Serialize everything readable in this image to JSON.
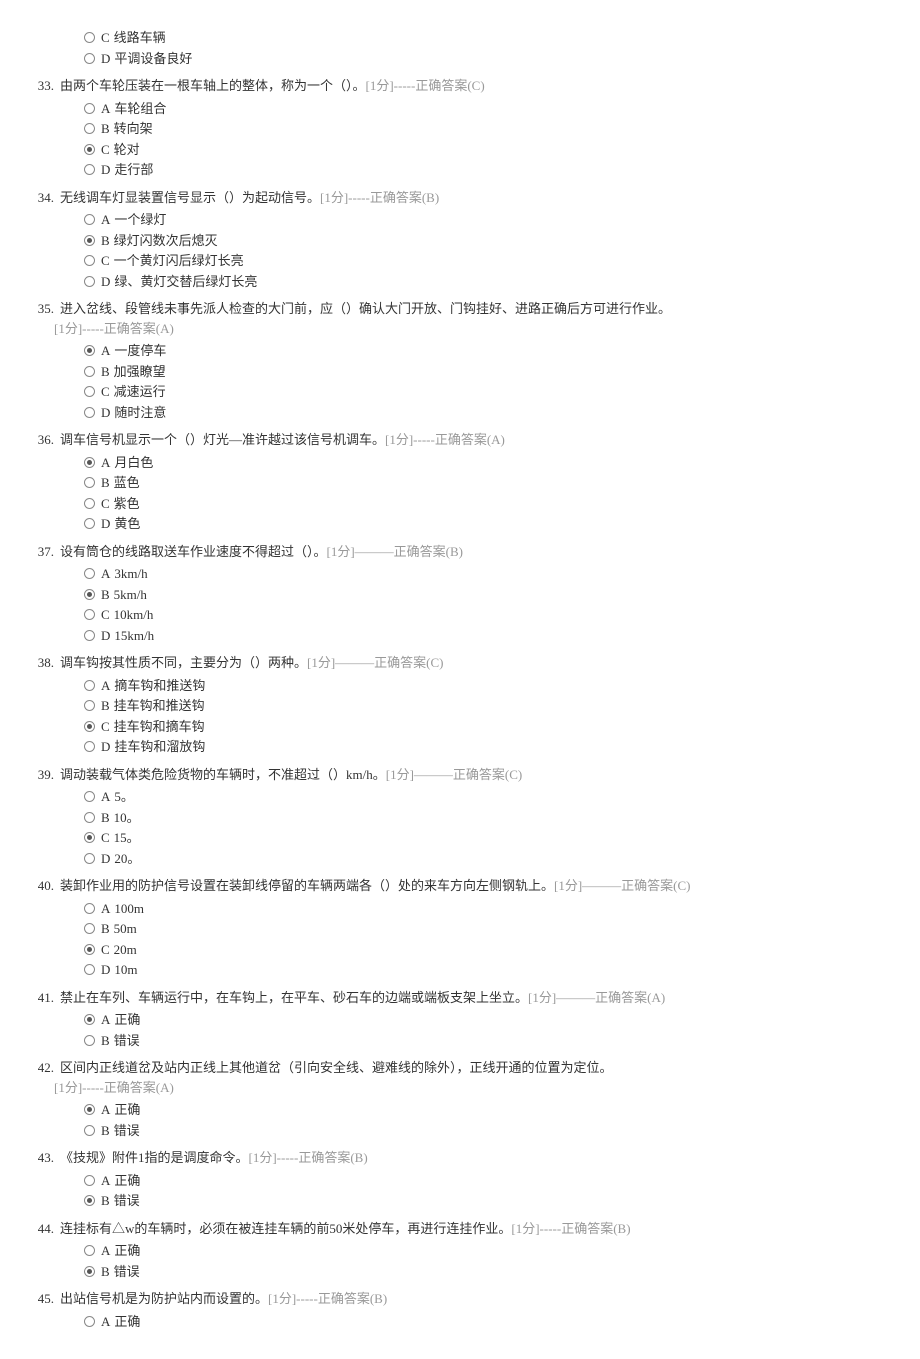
{
  "pretail_options": [
    {
      "letter": "C",
      "text": "线路车辆",
      "selected": false
    },
    {
      "letter": "D",
      "text": "平调设备良好",
      "selected": false
    }
  ],
  "questions": [
    {
      "number": "33.",
      "text": "由两个车轮压装在一根车轴上的整体，称为一个（）。",
      "meta": "[1分]-----正确答案(C)",
      "meta_on_newline": false,
      "options": [
        {
          "letter": "A",
          "text": "车轮组合",
          "selected": false
        },
        {
          "letter": "B",
          "text": "转向架",
          "selected": false
        },
        {
          "letter": "C",
          "text": "轮对",
          "selected": true
        },
        {
          "letter": "D",
          "text": "走行部",
          "selected": false
        }
      ]
    },
    {
      "number": "34.",
      "text": "无线调车灯显装置信号显示（）为起动信号。",
      "meta": "[1分]-----正确答案(B)",
      "meta_on_newline": false,
      "options": [
        {
          "letter": "A",
          "text": "一个绿灯",
          "selected": false
        },
        {
          "letter": "B",
          "text": "绿灯闪数次后熄灭",
          "selected": true
        },
        {
          "letter": "C",
          "text": "一个黄灯闪后绿灯长亮",
          "selected": false
        },
        {
          "letter": "D",
          "text": "绿、黄灯交替后绿灯长亮",
          "selected": false
        }
      ]
    },
    {
      "number": "35.",
      "text": "进入岔线、段管线未事先派人检查的大门前，应（）确认大门开放、门钩挂好、进路正确后方可进行作业。",
      "meta": "[1分]-----正确答案(A)",
      "meta_on_newline": true,
      "options": [
        {
          "letter": "A",
          "text": "一度停车",
          "selected": true
        },
        {
          "letter": "B",
          "text": "加强瞭望",
          "selected": false
        },
        {
          "letter": "C",
          "text": "减速运行",
          "selected": false
        },
        {
          "letter": "D",
          "text": "随时注意",
          "selected": false
        }
      ]
    },
    {
      "number": "36.",
      "text": "调车信号机显示一个（）灯光—准许越过该信号机调车。",
      "meta": "[1分]-----正确答案(A)",
      "meta_on_newline": false,
      "options": [
        {
          "letter": "A",
          "text": "月白色",
          "selected": true
        },
        {
          "letter": "B",
          "text": "蓝色",
          "selected": false
        },
        {
          "letter": "C",
          "text": "紫色",
          "selected": false
        },
        {
          "letter": "D",
          "text": "黄色",
          "selected": false
        }
      ]
    },
    {
      "number": "37.",
      "text": "设有筒仓的线路取送车作业速度不得超过（）。",
      "meta": "[1分]———正确答案(B)",
      "meta_on_newline": false,
      "options": [
        {
          "letter": "A",
          "text": "3km/h",
          "selected": false
        },
        {
          "letter": "B",
          "text": "5km/h",
          "selected": true
        },
        {
          "letter": "C",
          "text": "10km/h",
          "selected": false
        },
        {
          "letter": "D",
          "text": "15km/h",
          "selected": false
        }
      ]
    },
    {
      "number": "38.",
      "text": "调车钩按其性质不同，主要分为（）两种。",
      "meta": "[1分]———正确答案(C)",
      "meta_on_newline": false,
      "options": [
        {
          "letter": "A",
          "text": "摘车钩和推送钩",
          "selected": false
        },
        {
          "letter": "B",
          "text": "挂车钩和推送钩",
          "selected": false
        },
        {
          "letter": "C",
          "text": "挂车钩和摘车钩",
          "selected": true
        },
        {
          "letter": "D",
          "text": "挂车钩和溜放钩",
          "selected": false
        }
      ]
    },
    {
      "number": "39.",
      "text": "调动装载气体类危险货物的车辆时，不准超过（）km/h。",
      "meta": "[1分]———正确答案(C)",
      "meta_on_newline": false,
      "options": [
        {
          "letter": "A",
          "text": "5。",
          "selected": false
        },
        {
          "letter": "B",
          "text": "10。",
          "selected": false
        },
        {
          "letter": "C",
          "text": "15。",
          "selected": true
        },
        {
          "letter": "D",
          "text": "20。",
          "selected": false
        }
      ]
    },
    {
      "number": "40.",
      "text": "装卸作业用的防护信号设置在装卸线停留的车辆两端各（）处的来车方向左侧钢轨上。",
      "meta": "[1分]———正确答案(C)",
      "meta_on_newline": false,
      "options": [
        {
          "letter": "A",
          "text": "100m",
          "selected": false
        },
        {
          "letter": "B",
          "text": "50m",
          "selected": false
        },
        {
          "letter": "C",
          "text": "20m",
          "selected": true
        },
        {
          "letter": "D",
          "text": "10m",
          "selected": false
        }
      ]
    },
    {
      "number": "41.",
      "text": "禁止在车列、车辆运行中，在车钩上，在平车、砂石车的边端或端板支架上坐立。",
      "meta": "[1分]———正确答案(A)",
      "meta_on_newline": false,
      "options": [
        {
          "letter": "A",
          "text": "正确",
          "selected": true
        },
        {
          "letter": "B",
          "text": "错误",
          "selected": false
        }
      ]
    },
    {
      "number": "42.",
      "text": "区间内正线道岔及站内正线上其他道岔（引向安全线、避难线的除外），正线开通的位置为定位。",
      "meta": "[1分]-----正确答案(A)",
      "meta_on_newline": true,
      "options": [
        {
          "letter": "A",
          "text": "正确",
          "selected": true
        },
        {
          "letter": "B",
          "text": "错误",
          "selected": false
        }
      ]
    },
    {
      "number": "43.",
      "text": "《技规》附件1指的是调度命令。",
      "meta": "[1分]-----正确答案(B)",
      "meta_on_newline": false,
      "options": [
        {
          "letter": "A",
          "text": "正确",
          "selected": false
        },
        {
          "letter": "B",
          "text": "错误",
          "selected": true
        }
      ]
    },
    {
      "number": "44.",
      "text": "连挂标有△w的车辆时，必须在被连挂车辆的前50米处停车，再进行连挂作业。",
      "meta": "[1分]-----正确答案(B)",
      "meta_on_newline": false,
      "options": [
        {
          "letter": "A",
          "text": "正确",
          "selected": false
        },
        {
          "letter": "B",
          "text": "错误",
          "selected": true
        }
      ]
    },
    {
      "number": "45.",
      "text": "出站信号机是为防护站内而设置的。",
      "meta": "[1分]-----正确答案(B)",
      "meta_on_newline": false,
      "options": [
        {
          "letter": "A",
          "text": "正确",
          "selected": false
        }
      ]
    }
  ]
}
